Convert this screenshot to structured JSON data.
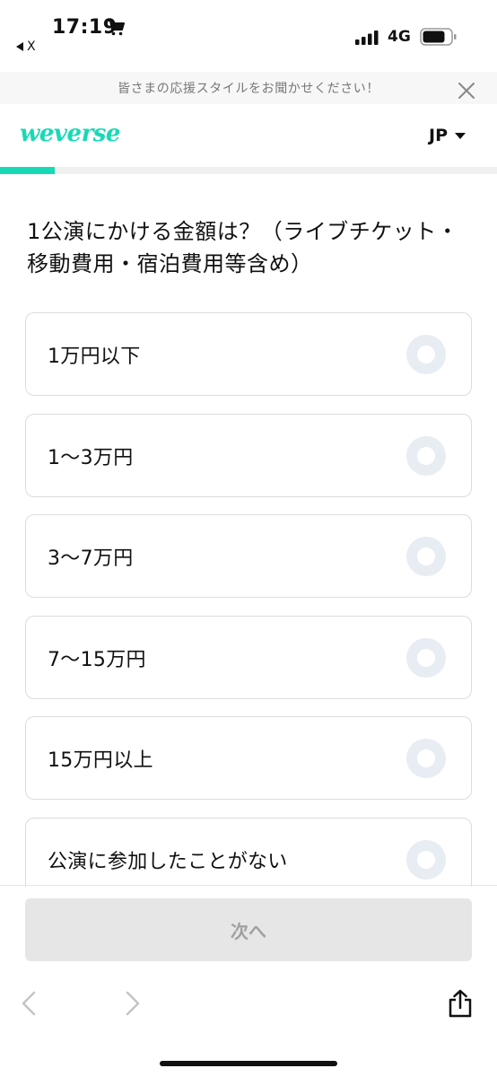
{
  "status_bar": {
    "time": "17:19",
    "back_app": "X",
    "network": "4G"
  },
  "banner": {
    "text": "皆さまの応援スタイルをお聞かせください！"
  },
  "header": {
    "logo": "weverse",
    "language": "JP"
  },
  "progress": {
    "fraction": 0.11
  },
  "question": {
    "text": "1公演にかける金額は？（ライブチケット・移動費用・宿泊費用等含め）"
  },
  "options": [
    {
      "label": "1万円以下"
    },
    {
      "label": "1〜3万円"
    },
    {
      "label": "3〜7万円"
    },
    {
      "label": "7〜15万円"
    },
    {
      "label": "15万円以上"
    },
    {
      "label": "公演に参加したことがない"
    }
  ],
  "actions": {
    "next_label": "次へ"
  },
  "colors": {
    "brand": "#18d9b6",
    "radio_unselected": "#e8ecf3",
    "button_disabled_bg": "#e6e6e6",
    "button_disabled_text": "#a0a0a0"
  }
}
